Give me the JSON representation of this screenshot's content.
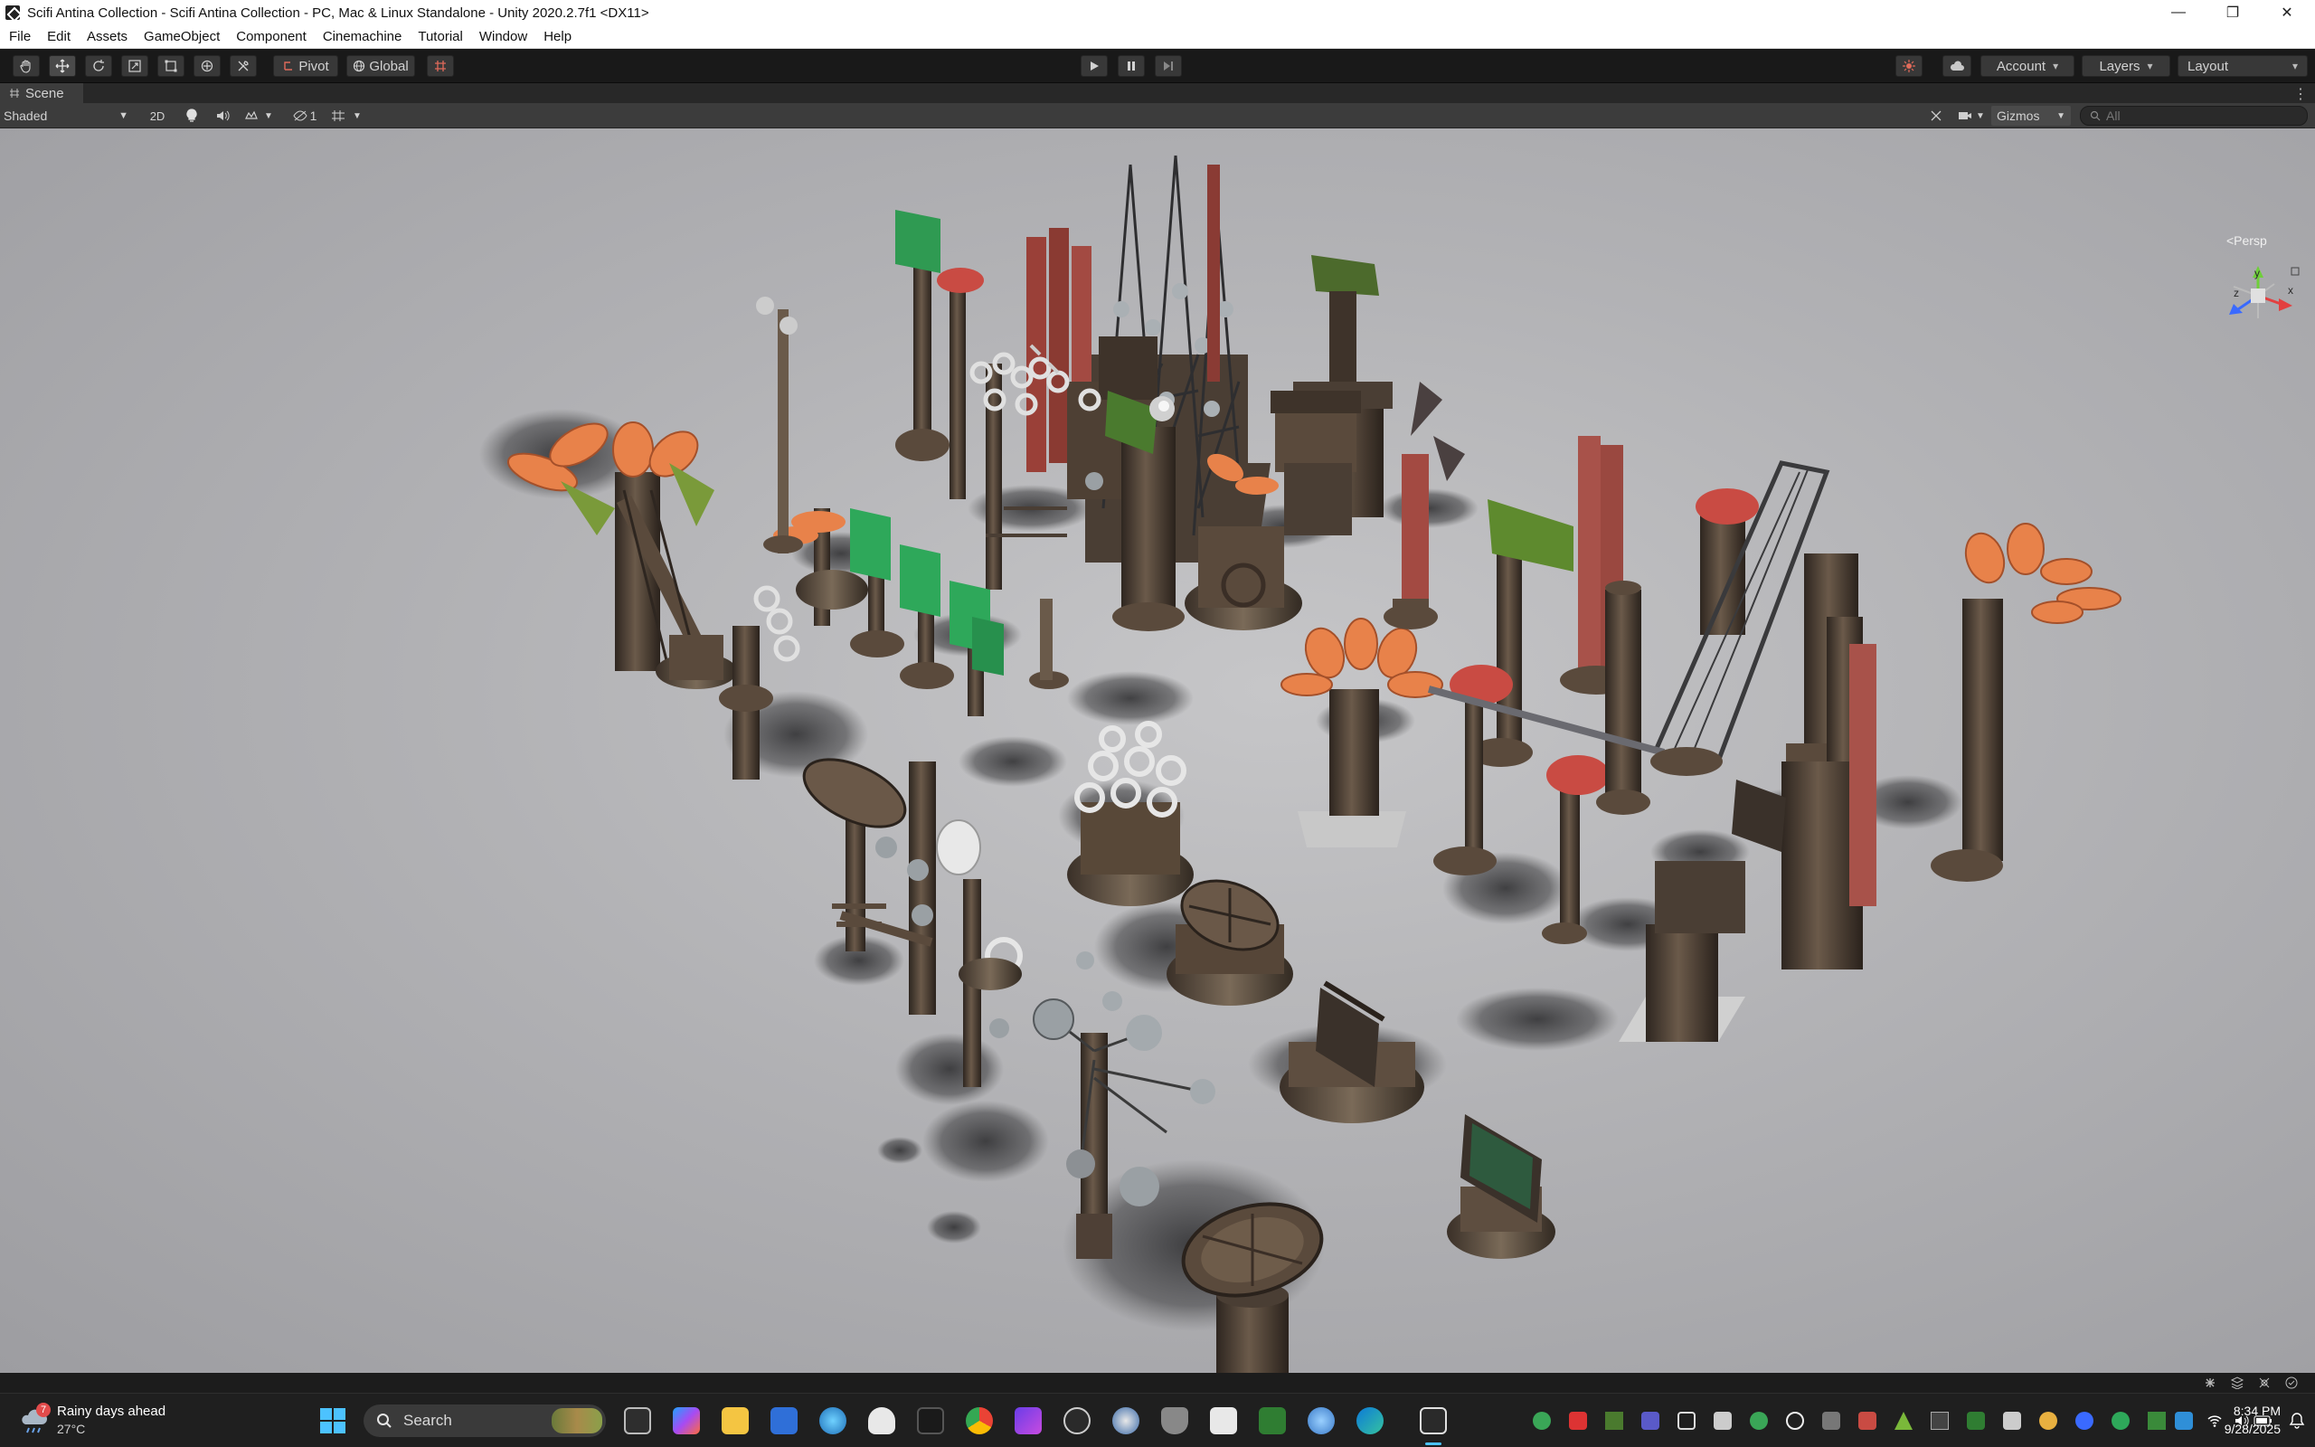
{
  "window": {
    "title": "Scifi Antina Collection - Scifi Antina Collection - PC, Mac & Linux Standalone - Unity 2020.2.7f1 <DX11>",
    "controls": {
      "minimize": "—",
      "maximize": "❐",
      "close": "✕"
    }
  },
  "menubar": {
    "items": [
      "File",
      "Edit",
      "Assets",
      "GameObject",
      "Component",
      "Cinemachine",
      "Tutorial",
      "Window",
      "Help"
    ]
  },
  "toolbar": {
    "pivot_label": "Pivot",
    "global_label": "Global",
    "account_label": "Account",
    "layers_label": "Layers",
    "layout_label": "Layout",
    "active_tool": "move-tool"
  },
  "scene": {
    "tab_label": "Scene",
    "draw_mode": "Shaded",
    "mode_2d": "2D",
    "visibility_count": "1",
    "gizmos_label": "Gizmos",
    "search_placeholder": "All",
    "projection_label": "<Persp",
    "gizmo_axes": {
      "x": "x",
      "y": "y",
      "z": "z"
    }
  },
  "colors": {
    "title_bg": "#ffffff",
    "toolbar_bg": "#191919",
    "scenebar_bg": "#3c3c3c",
    "viewport_ground": "#b8b8bb",
    "accent_orange": "#e8824a",
    "accent_green": "#3aa657",
    "accent_red": "#c8443c",
    "metal": "#4a3f36"
  },
  "taskbar": {
    "weather_badge": "7",
    "weather_title": "Rainy days ahead",
    "weather_temp": "27°C",
    "search_label": "Search",
    "time": "8:34 PM",
    "date": "9/28/2025"
  }
}
